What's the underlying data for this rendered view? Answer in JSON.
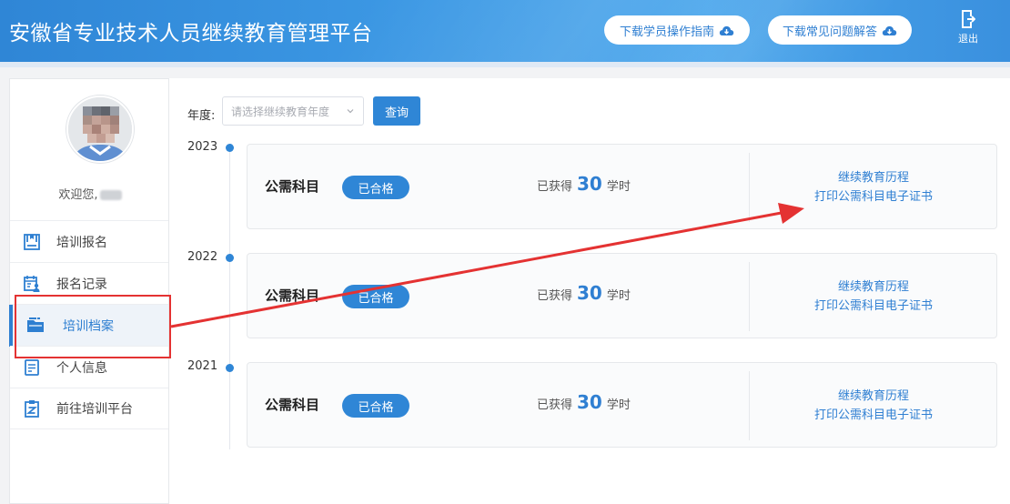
{
  "header": {
    "title": "安徽省专业技术人员继续教育管理平台",
    "download_guide": "下载学员操作指南",
    "download_faq": "下载常见问题解答",
    "logout": "退出",
    "icons": {
      "download": "cloud-download-icon",
      "logout": "logout-door-icon"
    }
  },
  "sidebar": {
    "welcome": "欢迎您,",
    "menu": [
      {
        "label": "培训报名",
        "icon": "book-icon"
      },
      {
        "label": "报名记录",
        "icon": "calendar-user-icon"
      },
      {
        "label": "培训档案",
        "icon": "folder-icon",
        "active": true
      },
      {
        "label": "个人信息",
        "icon": "document-icon"
      },
      {
        "label": "前往培训平台",
        "icon": "clipboard-icon"
      }
    ]
  },
  "filter": {
    "label": "年度:",
    "placeholder": "请选择继续教育年度",
    "query_button": "查询"
  },
  "records": [
    {
      "year": "2023",
      "subject": "公需科目",
      "status": "已合格",
      "hours_prefix": "已获得",
      "hours": "30",
      "hours_unit": "学时",
      "link_history": "继续教育历程",
      "link_cert": "打印公需科目电子证书"
    },
    {
      "year": "2022",
      "subject": "公需科目",
      "status": "已合格",
      "hours_prefix": "已获得",
      "hours": "30",
      "hours_unit": "学时",
      "link_history": "继续教育历程",
      "link_cert": "打印公需科目电子证书"
    },
    {
      "year": "2021",
      "subject": "公需科目",
      "status": "已合格",
      "hours_prefix": "已获得",
      "hours": "30",
      "hours_unit": "学时",
      "link_history": "继续教育历程",
      "link_cert": "打印公需科目电子证书"
    }
  ],
  "colors": {
    "primary": "#2f86d6",
    "annotation": "#e43232"
  }
}
